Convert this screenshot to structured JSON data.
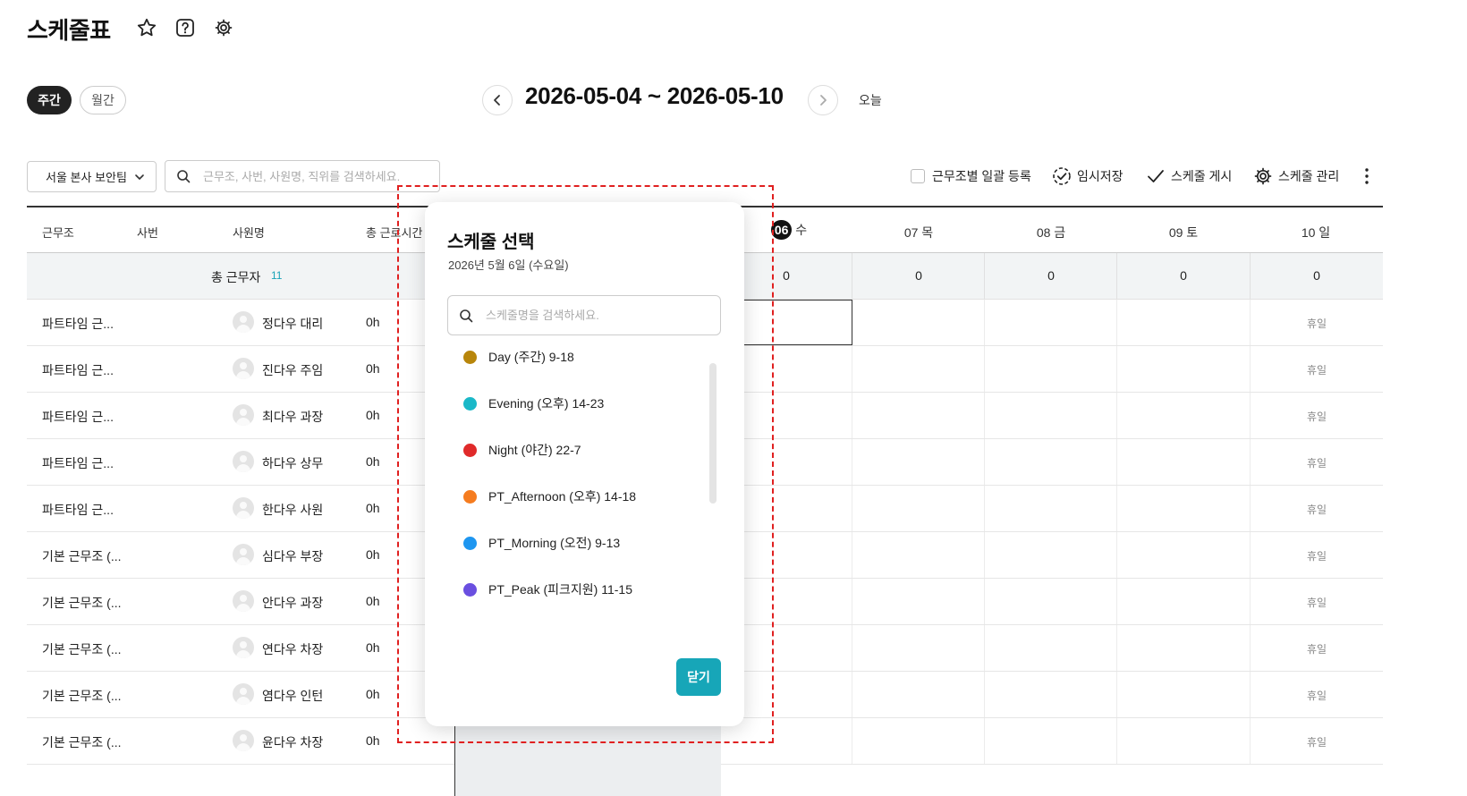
{
  "header": {
    "title": "스케줄표"
  },
  "view_toggle": {
    "weekly": "주간",
    "monthly": "월간"
  },
  "date_nav": {
    "range": "2026-05-04 ~ 2026-05-10",
    "today": "오늘"
  },
  "filters": {
    "team": "서울 본사 보안팀",
    "search_placeholder": "근무조, 사번, 사원명, 직위를 검색하세요."
  },
  "toolbar": {
    "bulk_register": "근무조별 일괄 등록",
    "temp_save": "임시저장",
    "publish": "스케줄 게시",
    "manage": "스케줄 관리"
  },
  "table": {
    "headers": {
      "shift": "근무조",
      "emp_no": "사번",
      "name": "사원명",
      "total_hours": "총 근로시간"
    },
    "today_day": {
      "num": "06",
      "dow": "수"
    },
    "days": [
      "07 목",
      "08 금",
      "09 토",
      "10 일"
    ],
    "summary": {
      "label": "총 근무자",
      "count": "11",
      "values": [
        "0",
        "0",
        "0",
        "0",
        "0"
      ]
    },
    "off_label": "휴일",
    "rows": [
      {
        "shift": "파트타임 근...",
        "name": "정다우 대리",
        "hours": "0h"
      },
      {
        "shift": "파트타임 근...",
        "name": "진다우 주임",
        "hours": "0h"
      },
      {
        "shift": "파트타임 근...",
        "name": "최다우 과장",
        "hours": "0h"
      },
      {
        "shift": "파트타임 근...",
        "name": "하다우 상무",
        "hours": "0h"
      },
      {
        "shift": "파트타임 근...",
        "name": "한다우 사원",
        "hours": "0h"
      },
      {
        "shift": "기본 근무조 (...",
        "name": "심다우 부장",
        "hours": "0h"
      },
      {
        "shift": "기본 근무조 (...",
        "name": "안다우 과장",
        "hours": "0h"
      },
      {
        "shift": "기본 근무조 (...",
        "name": "연다우 차장",
        "hours": "0h"
      },
      {
        "shift": "기본 근무조 (...",
        "name": "염다우 인턴",
        "hours": "0h"
      },
      {
        "shift": "기본 근무조 (...",
        "name": "윤다우 차장",
        "hours": "0h"
      }
    ]
  },
  "modal": {
    "title": "스케줄 선택",
    "date": "2026년 5월 6일 (수요일)",
    "search_placeholder": "스케줄명을 검색하세요.",
    "options": [
      {
        "label": "Day (주간) 9-18",
        "color": "#b8860b"
      },
      {
        "label": "Evening (오후) 14-23",
        "color": "#1ab8c8"
      },
      {
        "label": "Night (야간) 22-7",
        "color": "#e02a2a"
      },
      {
        "label": "PT_Afternoon (오후) 14-18",
        "color": "#f57c1f"
      },
      {
        "label": "PT_Morning (오전) 9-13",
        "color": "#1e96f0"
      },
      {
        "label": "PT_Peak (피크지원) 11-15",
        "color": "#6a4fe0"
      }
    ],
    "close": "닫기"
  },
  "colors": {
    "accent": "#17a6b8",
    "highlight_dash": "#e02020"
  }
}
